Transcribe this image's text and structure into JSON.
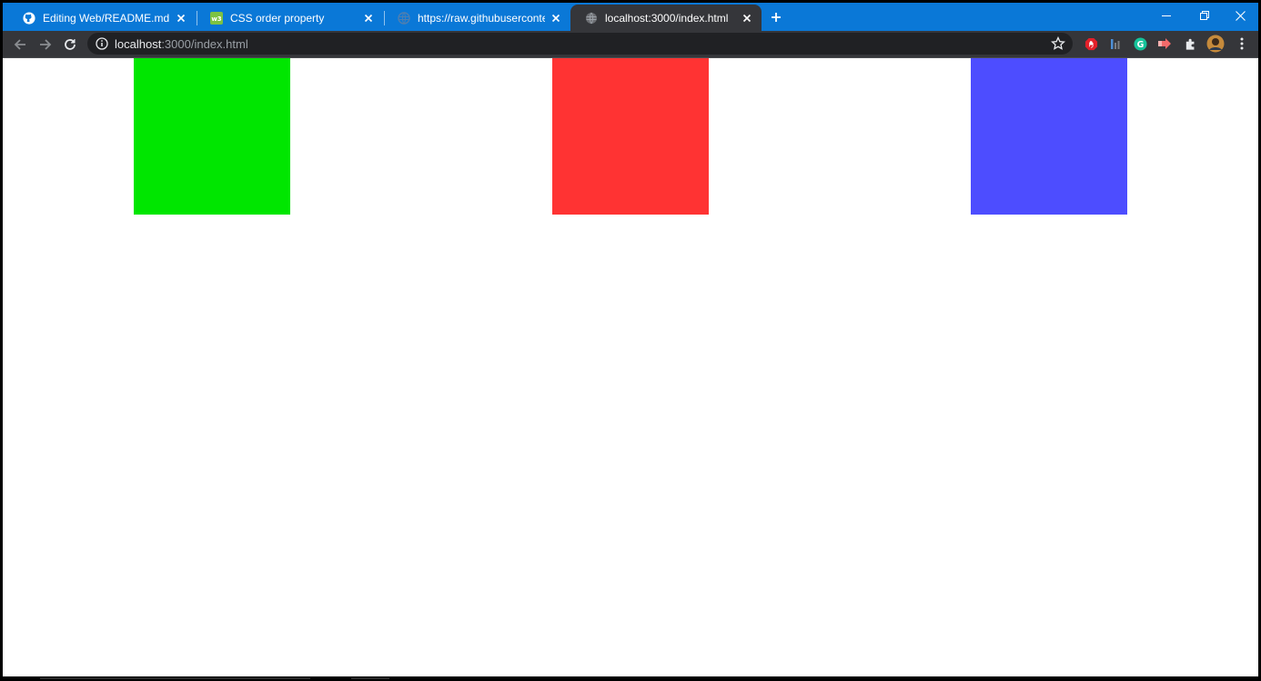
{
  "browser": {
    "tabs": [
      {
        "title": "Editing Web/README.md at main",
        "favicon": "github-icon",
        "active": false
      },
      {
        "title": "CSS order property",
        "favicon": "w3schools-icon",
        "active": false
      },
      {
        "title": "https://raw.githubusercontent.com",
        "favicon": "globe-icon",
        "active": false
      },
      {
        "title": "localhost:3000/index.html",
        "favicon": "globe-icon",
        "active": true
      }
    ],
    "address_bar": {
      "host": "localhost",
      "rest": ":3000/index.html"
    },
    "extensions": [
      "adblock-icon",
      "extension-bars-icon",
      "grammarly-icon",
      "extension-arrow-icon",
      "puzzle-icon",
      "avatar"
    ]
  },
  "page": {
    "boxes": [
      {
        "name": "green-box",
        "color": "#00e600"
      },
      {
        "name": "red-box",
        "color": "#ff3333"
      },
      {
        "name": "blue-box",
        "color": "#4d4dff"
      }
    ]
  },
  "colors": {
    "tabstrip": "#0a78d7",
    "toolbar": "#35363a",
    "omnibox": "#202124"
  }
}
